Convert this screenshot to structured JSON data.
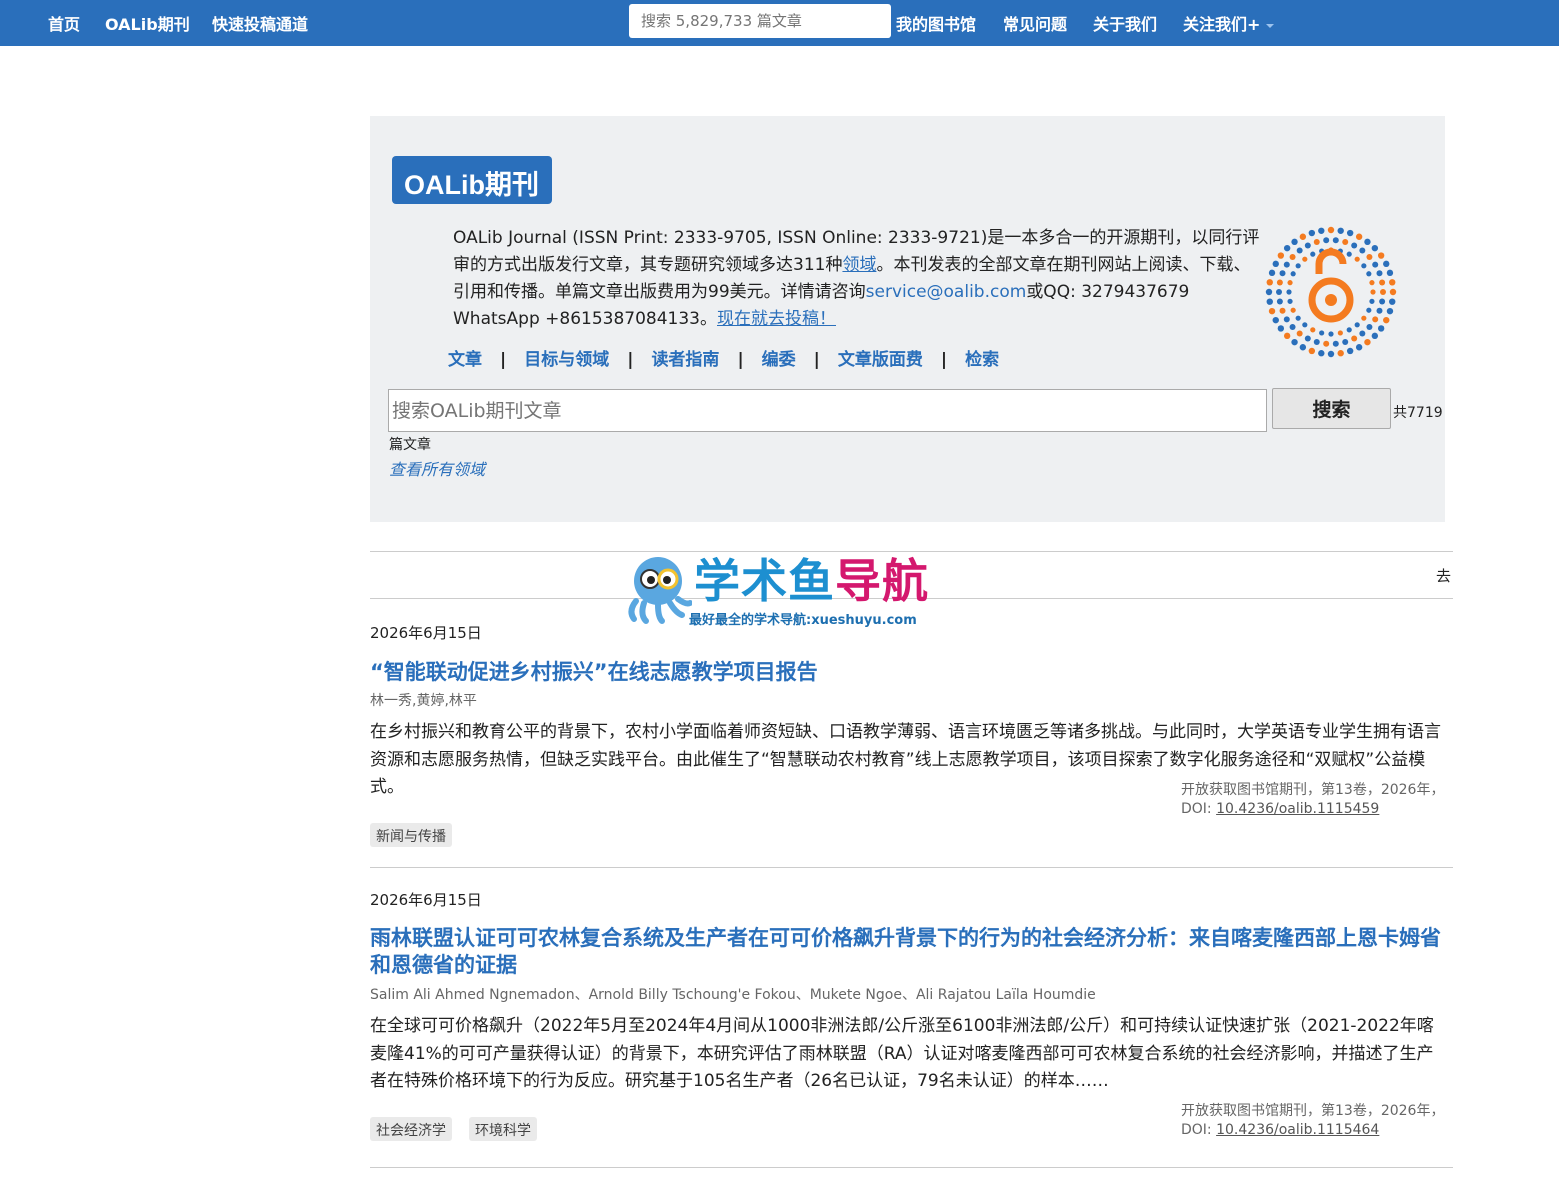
{
  "nav": {
    "home": "首页",
    "journal": "OALib期刊",
    "fast_submit": "快速投稿通道",
    "search_placeholder": "搜索 5,829,733 篇文章",
    "library": "我的图书馆",
    "faq": "常见问题",
    "about": "关于我们",
    "follow": "关注我们+"
  },
  "journal": {
    "badge": "OALib期刊",
    "desc_1": "OALib Journal (ISSN Print: 2333-9705, ISSN Online: 2333-9721)是一本多合一的开源期刊，以同行评审的方式出版发行文章，其专题研究领域多达311种",
    "desc_link_fields": "领域",
    "desc_2": "。本刊发表的全部文章在期刊网站上阅读、下载、引用和传播。单篇文章出版费用为99美元。详情请咨询",
    "email": "service@oalib.com",
    "desc_3": "或QQ: 3279437679 WhatsApp +8615387084133。",
    "submit_link": "现在就去投稿！",
    "links": [
      "文章",
      "目标与领域",
      "读者指南",
      "编委",
      "文章版面费",
      "检索"
    ],
    "search_placeholder": "搜索OALib期刊文章",
    "search_button": "搜索",
    "count_a": "共7719",
    "count_b": "篇文章",
    "view_all": "查看所有领域"
  },
  "go_label": "去",
  "watermark": {
    "title_a": "学术鱼",
    "title_b": "导航",
    "subtitle": "最好最全的学术导航:xueshuyu.com"
  },
  "articles": [
    {
      "date": "2026年6月15日",
      "title": "“智能联动促进乡村振兴”在线志愿教学项目报告",
      "authors": "林一秀,黄婷,林平",
      "abstract": "在乡村振兴和教育公平的背景下，农村小学面临着师资短缺、口语教学薄弱、语言环境匮乏等诸多挑战。与此同时，大学英语专业学生拥有语言资源和志愿服务热情，但缺乏实践平台。由此催生了“智慧联动农村教育”线上志愿教学项目，该项目探索了数字化服务途径和“双赋权”公益模式。",
      "journal": "开放获取图书馆期刊，第13卷，2026年，",
      "doi_label": "DOI:",
      "doi": "10.4236/oalib.1115459",
      "tags": [
        "新闻与传播"
      ]
    },
    {
      "date": "2026年6月15日",
      "title": "雨林联盟认证可可农林复合系统及生产者在可可价格飙升背景下的行为的社会经济分析：来自喀麦隆西部上恩卡姆省和恩德省的证据",
      "authors": "Salim Ali Ahmed Ngnemadon、Arnold Billy Tschoung'e Fokou、Mukete Ngoe、Ali Rajatou Laïla Houmdie",
      "abstract": "在全球可可价格飙升（2022年5月至2024年4月间从1000非洲法郎/公斤涨至6100非洲法郎/公斤）和可持续认证快速扩张（2021-2022年喀麦隆41%的可可产量获得认证）的背景下，本研究评估了雨林联盟（RA）认证对喀麦隆西部可可农林复合系统的社会经济影响，并描述了生产者在特殊价格环境下的行为反应。研究基于105名生产者（26名已认证，79名未认证）的样本……",
      "journal": "开放获取图书馆期刊，第13卷，2026年，",
      "doi_label": "DOI:",
      "doi": "10.4236/oalib.1115464",
      "tags": [
        "社会经济学",
        "环境科学"
      ]
    }
  ],
  "colors": {
    "nav_bg": "#2a6fbb",
    "link": "#2a6fbb",
    "box_bg": "#eef0f2"
  }
}
